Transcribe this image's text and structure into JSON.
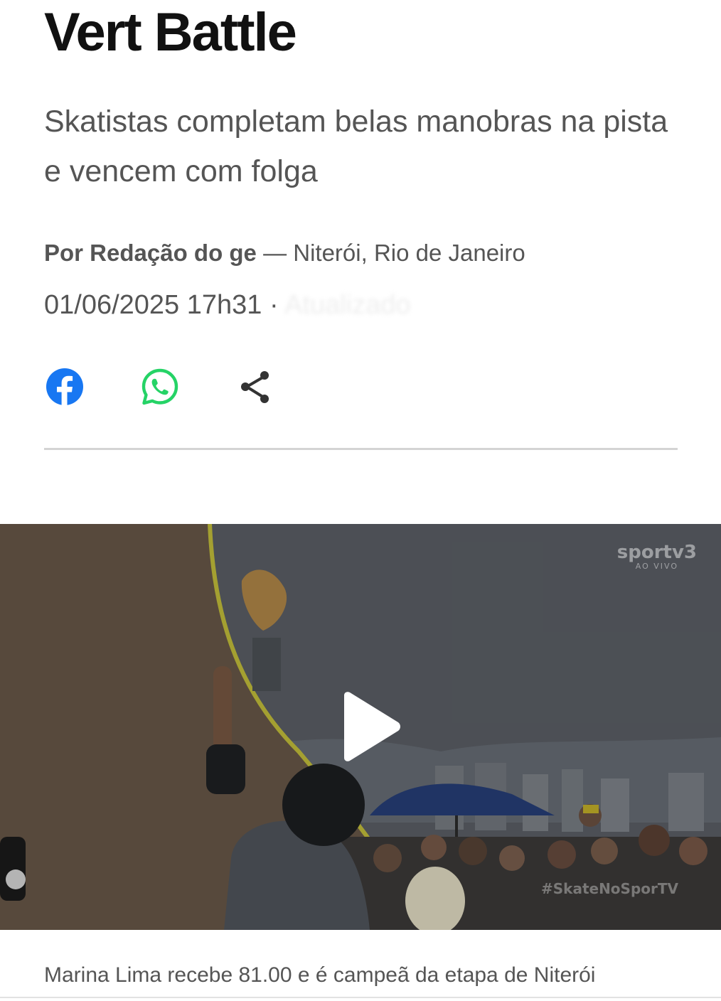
{
  "article": {
    "title": "Vert Battle",
    "subtitle": "Skatistas completam belas manobras na pista e vencem com folga",
    "author": "Por Redação do ge",
    "location": " — Niterói, Rio de Janeiro",
    "date": "01/06/2025 17h31",
    "separator": " · ",
    "updated": "Atualizado"
  },
  "share": {
    "facebook_icon": "facebook-icon",
    "whatsapp_icon": "whatsapp-icon",
    "share_icon": "share-icon",
    "colors": {
      "facebook": "#1877F2",
      "whatsapp": "#25D366",
      "share": "#333333"
    }
  },
  "video": {
    "channel": "sportv3",
    "channel_sub": "AO VIVO",
    "hashtag": "#SkateNoSporTV",
    "play_icon": "play-icon",
    "caption": "Marina Lima recebe 81.00 e é campeã da etapa de Niterói"
  }
}
